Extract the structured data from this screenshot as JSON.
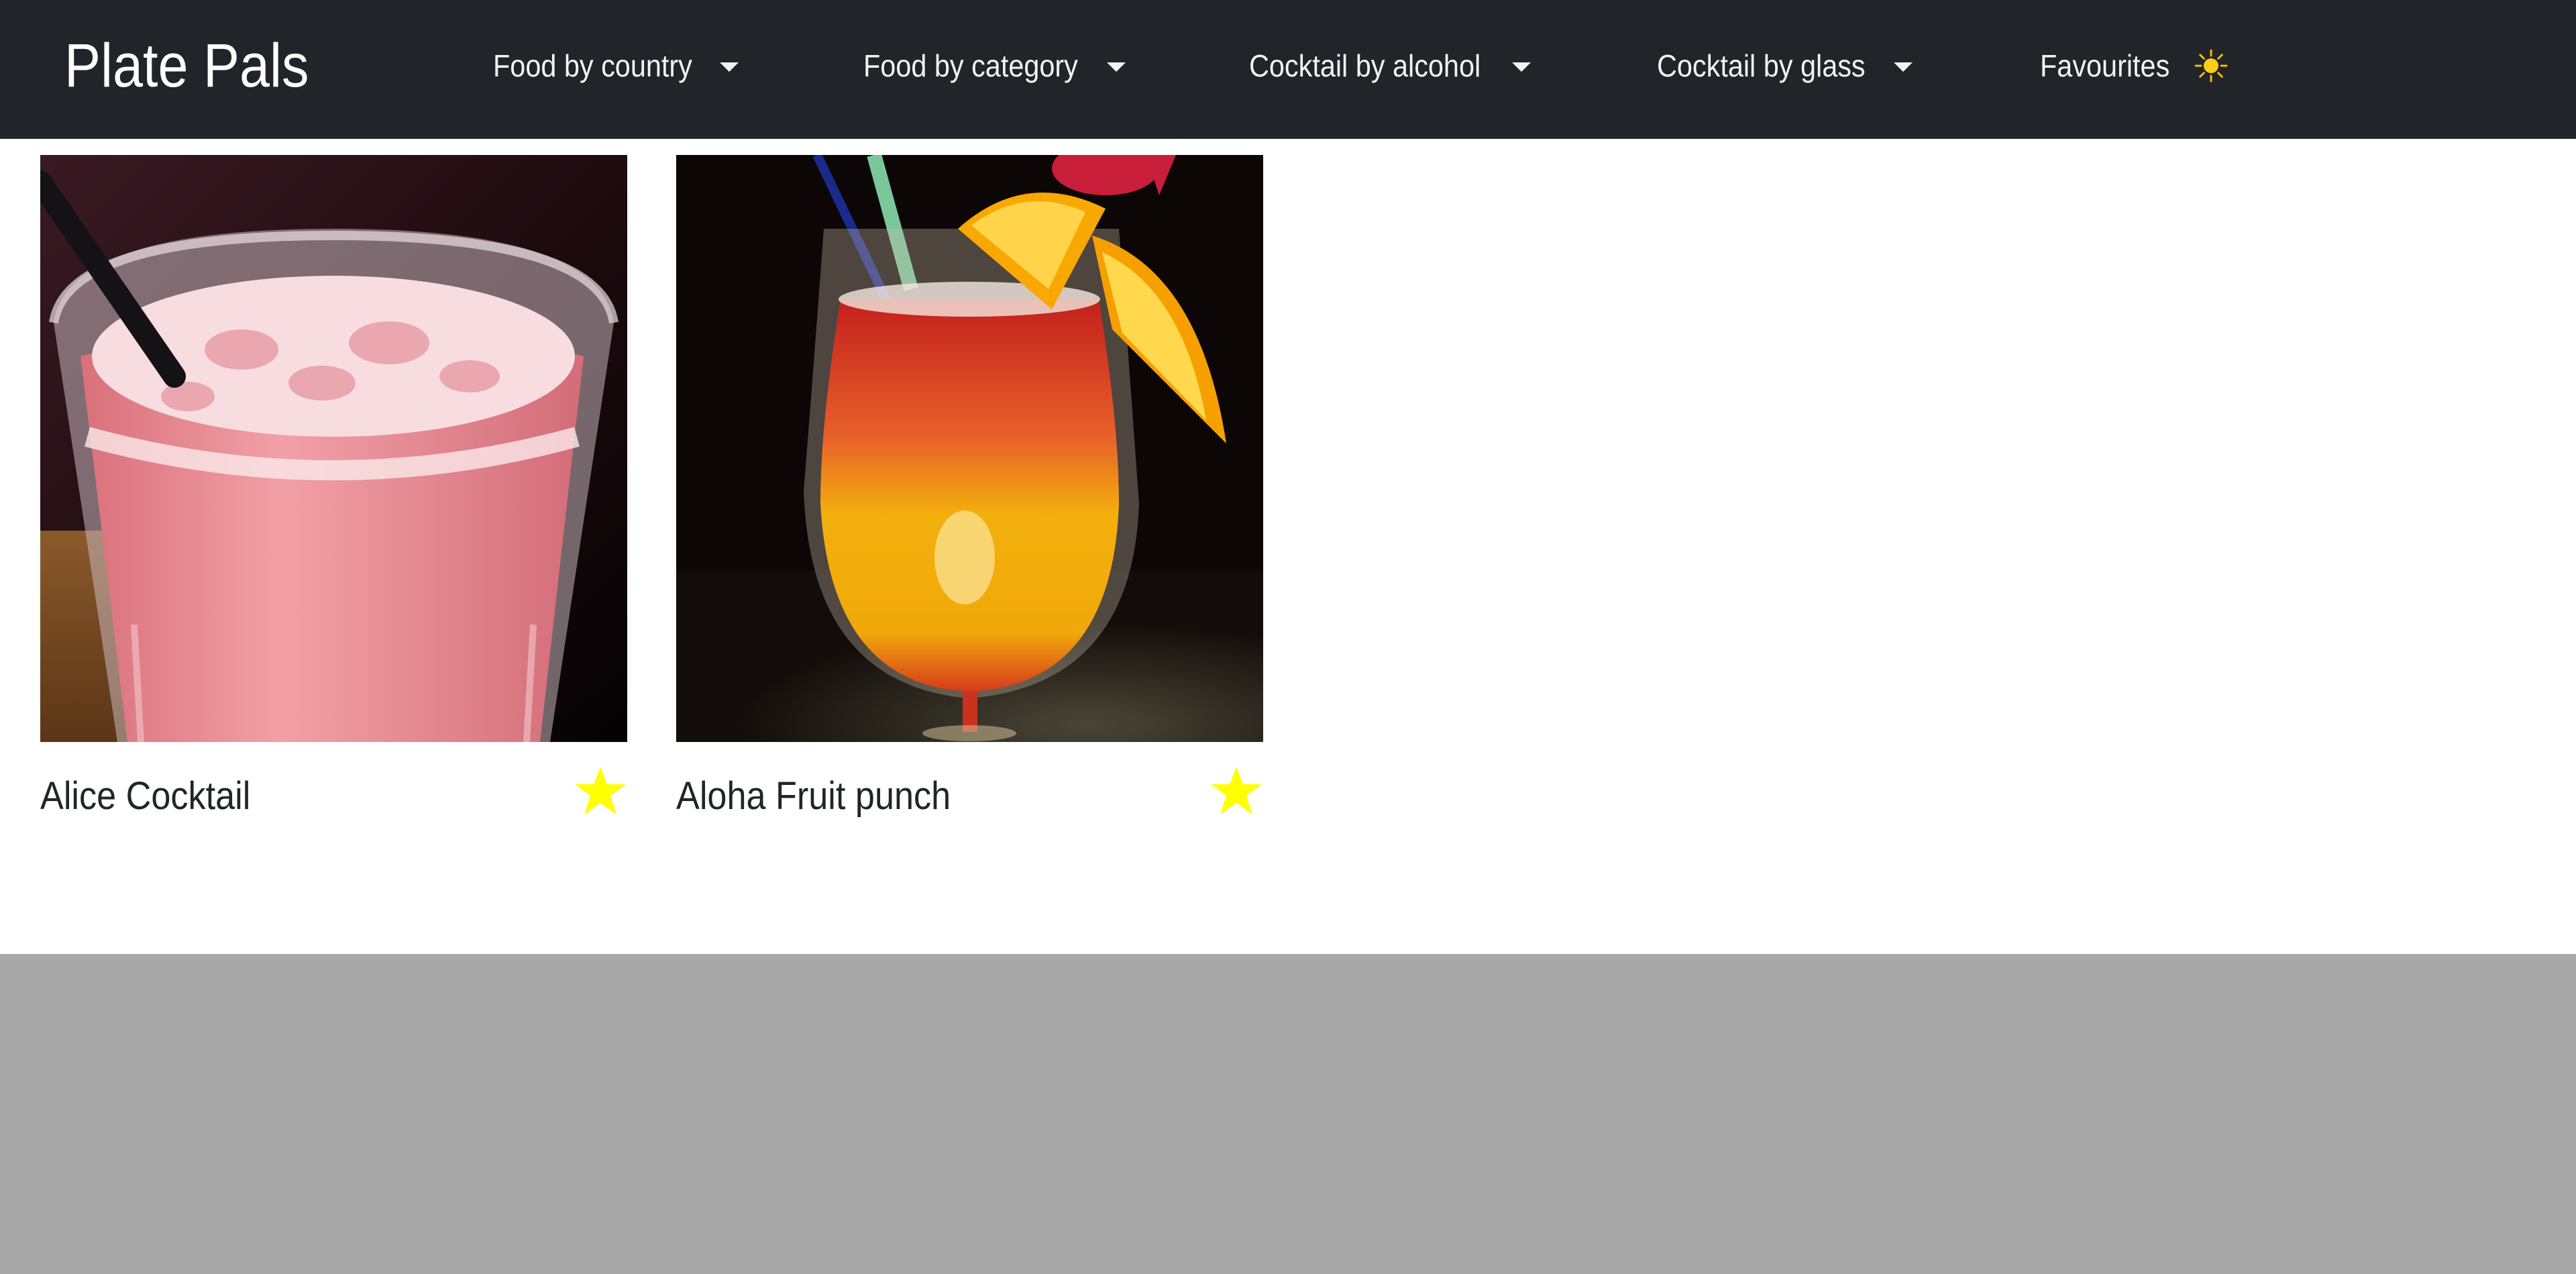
{
  "navbar": {
    "brand": "Plate Pals",
    "items": [
      {
        "label": "Food by country",
        "dropdown": true
      },
      {
        "label": "Food by category",
        "dropdown": true
      },
      {
        "label": "Cocktail by alcohol",
        "dropdown": true
      },
      {
        "label": "Cocktail by glass",
        "dropdown": true
      },
      {
        "label": "Favourites",
        "icon": "sun-icon"
      }
    ]
  },
  "cards": [
    {
      "title": "Alice Cocktail",
      "image": "pink-cocktail-photo",
      "favourite": true
    },
    {
      "title": "Aloha Fruit punch",
      "image": "fruit-punch-photo",
      "favourite": true
    }
  ],
  "colors": {
    "navbar_bg": "#212529",
    "star": "#ffff00",
    "footer_bg": "#a8a8a8"
  }
}
